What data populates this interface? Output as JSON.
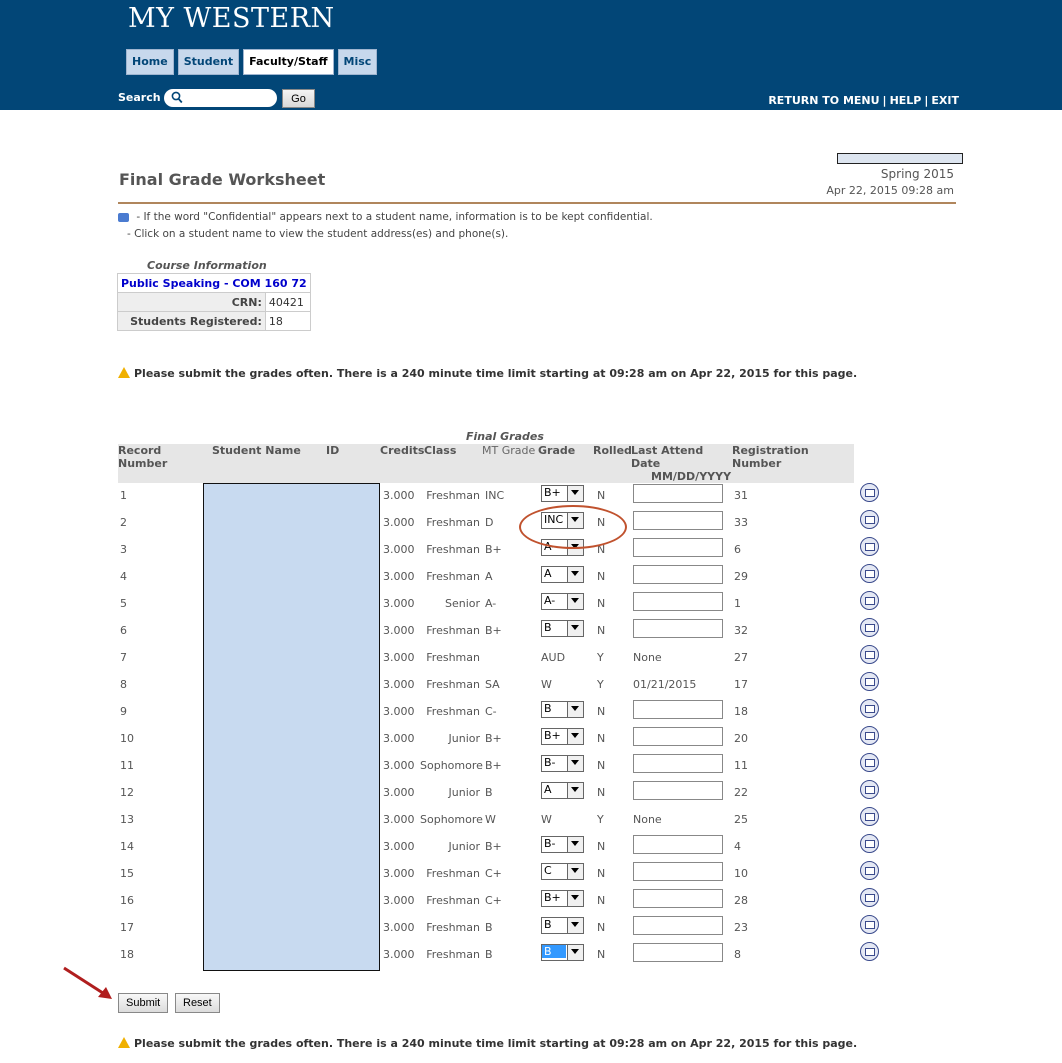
{
  "header": {
    "logo": "MY WESTERN",
    "nav": [
      {
        "label": "Home",
        "active": false
      },
      {
        "label": "Student",
        "active": false
      },
      {
        "label": "Faculty/Staff",
        "active": true
      },
      {
        "label": "Misc",
        "active": false
      }
    ],
    "search_label": "Search",
    "search_placeholder": "",
    "go_label": "Go",
    "links": [
      "RETURN TO MENU",
      "HELP",
      "EXIT"
    ],
    "colors": {
      "brand": "#024677",
      "accent_rule": "#b0865c",
      "highlight": "#3399ff"
    }
  },
  "page": {
    "term": "Spring 2015",
    "datetime": "Apr 22, 2015 09:28 am",
    "title": "Final Grade Worksheet",
    "note1": " - If the word \"Confidential\" appears next to a student name, information is to be kept confidential.",
    "note2": "- Click on a student name to view the student address(es) and phone(s).",
    "warning": "Please submit the grades often. There is a 240 minute time limit starting at 09:28 am on Apr 22, 2015 for this page."
  },
  "course": {
    "caption": "Course Information",
    "name": "Public Speaking - COM 160 72",
    "crn_label": "CRN:",
    "crn": "40421",
    "registered_label": "Students Registered:",
    "registered": "18"
  },
  "grades": {
    "caption": "Final Grades",
    "headers": {
      "record": "Record Number",
      "name": "Student Name",
      "id": "ID",
      "credits": "Credits",
      "class": "Class",
      "mt": "MT Grade",
      "grade": "Grade",
      "rolled": "Rolled",
      "last_attend": "Last Attend Date",
      "last_attend_fmt": "MM/DD/YYYY",
      "reg": "Registration Number"
    },
    "rows": [
      {
        "num": "1",
        "credits": "3.000",
        "cls": "Freshman",
        "mt": "INC",
        "grade": "B+",
        "editable": true,
        "rolled": "N",
        "date": "",
        "reg": "31"
      },
      {
        "num": "2",
        "credits": "3.000",
        "cls": "Freshman",
        "mt": "D",
        "grade": "INC",
        "editable": true,
        "rolled": "N",
        "date": "",
        "reg": "33"
      },
      {
        "num": "3",
        "credits": "3.000",
        "cls": "Freshman",
        "mt": "B+",
        "grade": "A-",
        "editable": true,
        "rolled": "N",
        "date": "",
        "reg": "6"
      },
      {
        "num": "4",
        "credits": "3.000",
        "cls": "Freshman",
        "mt": "A",
        "grade": "A",
        "editable": true,
        "rolled": "N",
        "date": "",
        "reg": "29"
      },
      {
        "num": "5",
        "credits": "3.000",
        "cls": "Senior",
        "mt": "A-",
        "grade": "A-",
        "editable": true,
        "rolled": "N",
        "date": "",
        "reg": "1"
      },
      {
        "num": "6",
        "credits": "3.000",
        "cls": "Freshman",
        "mt": "B+",
        "grade": "B",
        "editable": true,
        "rolled": "N",
        "date": "",
        "reg": "32"
      },
      {
        "num": "7",
        "credits": "3.000",
        "cls": "Freshman",
        "mt": "",
        "grade": "AUD",
        "editable": false,
        "rolled": "Y",
        "date": "None",
        "reg": "27"
      },
      {
        "num": "8",
        "credits": "3.000",
        "cls": "Freshman",
        "mt": "SA",
        "grade": "W",
        "editable": false,
        "rolled": "Y",
        "date": "01/21/2015",
        "reg": "17"
      },
      {
        "num": "9",
        "credits": "3.000",
        "cls": "Freshman",
        "mt": "C-",
        "grade": "B",
        "editable": true,
        "rolled": "N",
        "date": "",
        "reg": "18"
      },
      {
        "num": "10",
        "credits": "3.000",
        "cls": "Junior",
        "mt": "B+",
        "grade": "B+",
        "editable": true,
        "rolled": "N",
        "date": "",
        "reg": "20"
      },
      {
        "num": "11",
        "credits": "3.000",
        "cls": "Sophomore",
        "mt": "B+",
        "grade": "B-",
        "editable": true,
        "rolled": "N",
        "date": "",
        "reg": "11"
      },
      {
        "num": "12",
        "credits": "3.000",
        "cls": "Junior",
        "mt": "B",
        "grade": "A",
        "editable": true,
        "rolled": "N",
        "date": "",
        "reg": "22"
      },
      {
        "num": "13",
        "credits": "3.000",
        "cls": "Sophomore",
        "mt": "W",
        "grade": "W",
        "editable": false,
        "rolled": "Y",
        "date": "None",
        "reg": "25"
      },
      {
        "num": "14",
        "credits": "3.000",
        "cls": "Junior",
        "mt": "B+",
        "grade": "B-",
        "editable": true,
        "rolled": "N",
        "date": "",
        "reg": "4"
      },
      {
        "num": "15",
        "credits": "3.000",
        "cls": "Freshman",
        "mt": "C+",
        "grade": "C",
        "editable": true,
        "rolled": "N",
        "date": "",
        "reg": "10"
      },
      {
        "num": "16",
        "credits": "3.000",
        "cls": "Freshman",
        "mt": "C+",
        "grade": "B+",
        "editable": true,
        "rolled": "N",
        "date": "",
        "reg": "28"
      },
      {
        "num": "17",
        "credits": "3.000",
        "cls": "Freshman",
        "mt": "B",
        "grade": "B",
        "editable": true,
        "rolled": "N",
        "date": "",
        "reg": "23"
      },
      {
        "num": "18",
        "credits": "3.000",
        "cls": "Freshman",
        "mt": "B",
        "grade": "B",
        "editable": true,
        "rolled": "N",
        "date": "",
        "reg": "8",
        "highlighted": true
      }
    ]
  },
  "actions": {
    "submit": "Submit",
    "reset": "Reset"
  }
}
